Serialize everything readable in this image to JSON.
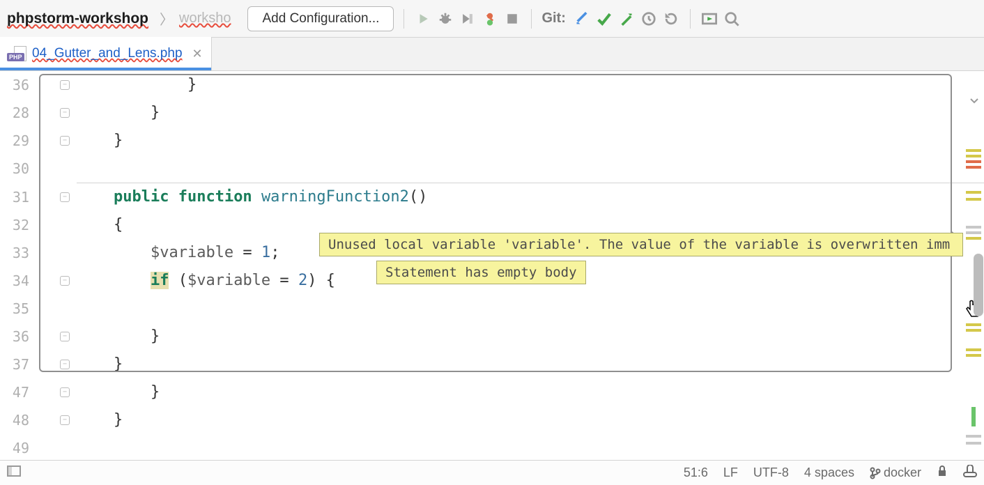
{
  "breadcrumb": {
    "root": "phpstorm-workshop",
    "child": "worksho"
  },
  "toolbar": {
    "config": "Add Configuration...",
    "git_label": "Git:"
  },
  "tab": {
    "title": "04_Gutter_and_Lens.php"
  },
  "code": {
    "l26": "            }",
    "l28": "        }",
    "l29": "    }",
    "l30": "",
    "l31_pre": "    ",
    "l31_public": "public",
    "l31_function": "function",
    "l31_name": "warningFunction2",
    "l31_post": "()",
    "l32": "    {",
    "l33_pre": "        ",
    "l33_var": "$variable",
    "l33_mid": " = ",
    "l33_num": "1",
    "l33_post": ";",
    "l34_pre": "        ",
    "l34_if": "if",
    "l34_mid1": " (",
    "l34_var": "$variable",
    "l34_mid2": " = ",
    "l34_num": "2",
    "l34_post": ") {",
    "l35": "",
    "l36": "        }",
    "l37": "    }",
    "l47": "        }",
    "l48": "    }",
    "l49": ""
  },
  "linenums": [
    "36",
    "28",
    "29",
    "30",
    "31",
    "32",
    "33",
    "34",
    "35",
    "36",
    "37",
    "47",
    "48",
    "49"
  ],
  "tips": {
    "t1": "Unused local variable 'variable'. The value of the variable is overwritten imm",
    "t2": "Statement has empty body"
  },
  "status": {
    "caret": "51:6",
    "eol": "LF",
    "enc": "UTF-8",
    "indent": "4 spaces",
    "branch": "docker"
  }
}
